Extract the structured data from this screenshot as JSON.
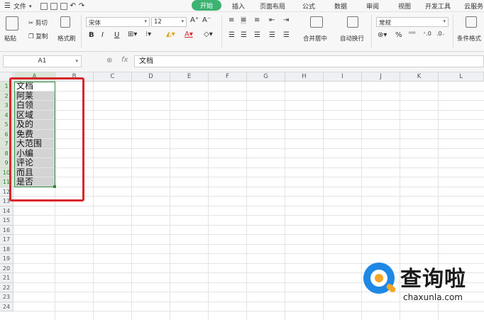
{
  "menu": {
    "file_label": "文件",
    "tabs": [
      "开始",
      "插入",
      "页面布局",
      "公式",
      "数据",
      "审阅",
      "视图",
      "开发工具",
      "云服务"
    ],
    "active_tab": "开始"
  },
  "ribbon": {
    "paste": "粘贴",
    "cut": "剪切",
    "copy": "复制",
    "format_painter": "格式刷",
    "font_name": "宋体",
    "font_size": "12",
    "bold": "B",
    "italic": "I",
    "underline": "U",
    "grow_font": "A⁺",
    "shrink_font": "A⁻",
    "merge_center": "合并居中",
    "wrap_text": "自动换行",
    "number_format": "常规",
    "percent": "%",
    "conditional_format": "条件格式"
  },
  "formula_bar": {
    "name_box": "A1",
    "fx": "fx",
    "content": "文档"
  },
  "sheet": {
    "columns": [
      "A",
      "B",
      "C",
      "D",
      "E",
      "F",
      "G",
      "H",
      "I",
      "J",
      "K",
      "L"
    ],
    "rows": [
      "1",
      "2",
      "3",
      "4",
      "5",
      "6",
      "7",
      "8",
      "9",
      "10",
      "11",
      "12",
      "13",
      "14",
      "15",
      "16",
      "17",
      "18",
      "19",
      "20",
      "21",
      "22",
      "23",
      "24"
    ],
    "cells_a": [
      "文档",
      "阿莱",
      "白领",
      "区域",
      "及的",
      "免费",
      "大范围",
      "小编",
      "评论",
      "而且",
      "是否"
    ]
  },
  "watermark": {
    "cn": "查询啦",
    "en": "chaxunla.com"
  },
  "colors": {
    "accent_green": "#3cb371",
    "selection_border": "#2e8b3e",
    "highlight_red": "#d9262c",
    "watermark_blue": "#1e88e5",
    "watermark_orange": "#f5a623"
  }
}
